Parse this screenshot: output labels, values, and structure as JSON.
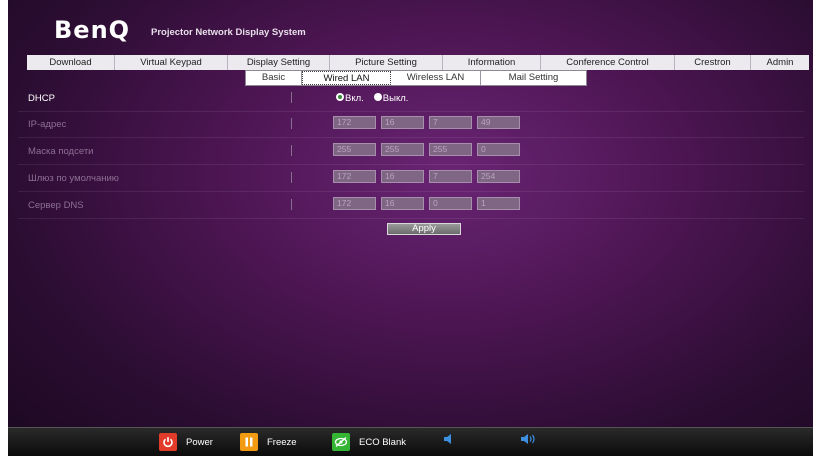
{
  "header": {
    "logo": "BenQ",
    "system_title": "Projector Network Display System"
  },
  "main_nav": [
    {
      "label": "Download"
    },
    {
      "label": "Virtual Keypad"
    },
    {
      "label": "Display Setting"
    },
    {
      "label": "Picture Setting"
    },
    {
      "label": "Information"
    },
    {
      "label": "Conference Control"
    },
    {
      "label": "Crestron"
    },
    {
      "label": "Admin"
    }
  ],
  "sub_nav": [
    {
      "label": "Basic"
    },
    {
      "label": "Wired LAN",
      "active": true
    },
    {
      "label": "Wireless LAN"
    },
    {
      "label": "Mail Setting"
    }
  ],
  "form": {
    "dhcp": {
      "label": "DHCP",
      "options": [
        {
          "label": "Вкл.",
          "selected": true
        },
        {
          "label": "Выкл.",
          "selected": false
        }
      ]
    },
    "ip_address": {
      "label": "IP-адрес",
      "values": [
        "172",
        "16",
        "7",
        "49"
      ]
    },
    "subnet_mask": {
      "label": "Маска подсети",
      "values": [
        "255",
        "255",
        "255",
        "0"
      ]
    },
    "default_gateway": {
      "label": "Шлюз по умолчанию",
      "values": [
        "172",
        "16",
        "7",
        "254"
      ]
    },
    "dns_server": {
      "label": "Сервер DNS",
      "values": [
        "172",
        "16",
        "0",
        "1"
      ]
    },
    "apply_label": "Apply"
  },
  "bottom_bar": {
    "power_label": "Power",
    "freeze_label": "Freeze",
    "eco_blank_label": "ECO Blank"
  },
  "colors": {
    "power_icon": "#e23b2a",
    "freeze_icon": "#f29a12",
    "eco_icon": "#35b534",
    "volume_icon": "#3d8fe0"
  }
}
